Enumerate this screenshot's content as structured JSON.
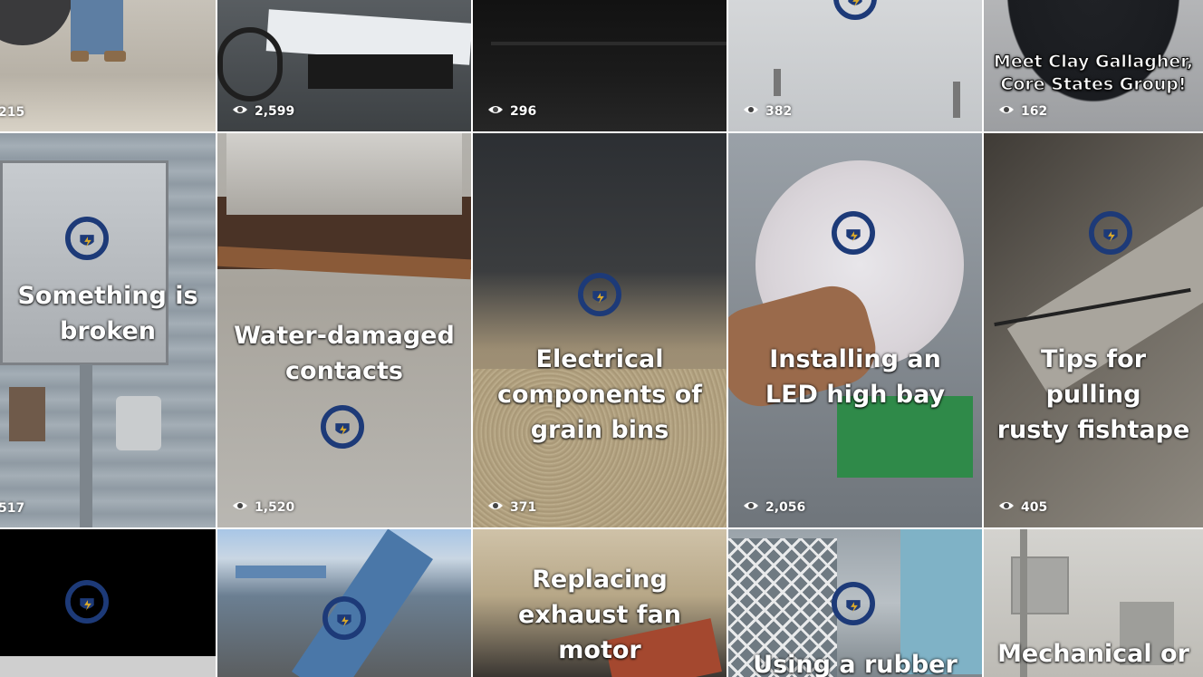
{
  "logo": {
    "ring_top": "THE EVERYDAY",
    "ring_bottom": "ELECTRICIAN",
    "gold": "#d9a92b",
    "navy": "#1d3a78"
  },
  "colors": {
    "text": "#ffffff"
  },
  "tiles": [
    {
      "caption": "",
      "views": "215"
    },
    {
      "caption": "",
      "views": "2,599"
    },
    {
      "caption": "",
      "views": "296"
    },
    {
      "caption": "",
      "views": "382"
    },
    {
      "caption": "Meet Clay Gallagher,\nCore States Group!",
      "views": "162"
    },
    {
      "caption": "Something is\nbroken",
      "views": "517"
    },
    {
      "caption": "Water-damaged\ncontacts",
      "views": "1,520"
    },
    {
      "caption": "Electrical\ncomponents of\ngrain bins",
      "views": "371"
    },
    {
      "caption": "Installing an\nLED high bay",
      "views": "2,056"
    },
    {
      "caption": "Tips for pulling\nrusty fishtape",
      "views": "405"
    },
    {
      "caption": "",
      "views": ""
    },
    {
      "caption": "",
      "views": ""
    },
    {
      "caption": "Replacing\nexhaust fan\nmotor",
      "views": ""
    },
    {
      "caption": "Using a rubber",
      "views": ""
    },
    {
      "caption": "Mechanical or",
      "views": ""
    }
  ]
}
